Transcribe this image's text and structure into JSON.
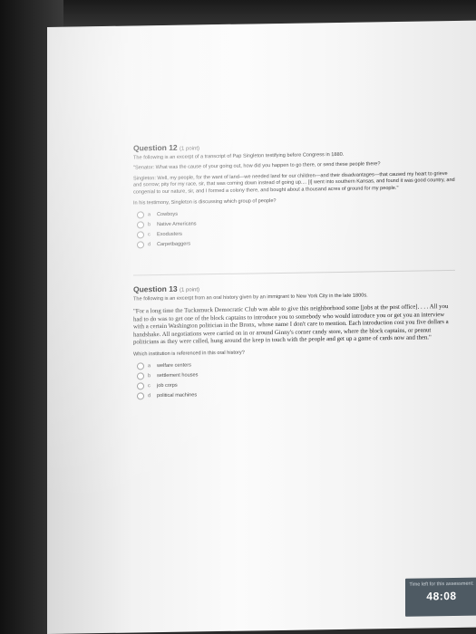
{
  "q12": {
    "title": "Question 12",
    "points": "(1 point)",
    "intro": "The following is an excerpt of a transcript of Pap Singleton testifying before Congress in 1880.",
    "question_line": "\"Senator: What was the cause of your going out, how did you happen to go there, or send these people there?",
    "answer": "Singleton: Well, my people, for the want of land—we needed land for our children—and their disadvantages—that caused my heart to grieve and sorrow; pity for my race, sir, that was coming down instead of going up.... [I] went into southern Kansas, and found it was good country, and congenial to our nature, sir, and I formed a colony there, and bought about a thousand acres of ground for my people.\"",
    "prompt": "In his testimony, Singleton is discussing which group of people?",
    "options": [
      {
        "letter": "a",
        "label": "Cowboys"
      },
      {
        "letter": "b",
        "label": "Native Americans"
      },
      {
        "letter": "c",
        "label": "Exodusters"
      },
      {
        "letter": "d",
        "label": "Carpetbaggers"
      }
    ]
  },
  "q13": {
    "title": "Question 13",
    "points": "(1 point)",
    "intro": "The following is an excerpt from an oral history given by an immigrant to New York City in the late 1800s.",
    "quote": "\"For a long time the Tuckamuck Democratic Club was able to give this neighborhood some [jobs at the post office]. . . . All you had to do was to get one of the block captains to introduce you to somebody who would introduce you or get you an interview with a certain Washington politician in the Bronx, whose name I don't care to mention. Each introduction cost you five dollars a handshake. All negotiations were carried on in or around Ginny's corner candy store, where the block captains, or peanut politicians as they were called, hung around the keep in touch with the people and get up a game of cards now and then.\"",
    "prompt": "Which institution is referenced in this oral history?",
    "options": [
      {
        "letter": "a",
        "label": "welfare centers"
      },
      {
        "letter": "b",
        "label": "settlement houses"
      },
      {
        "letter": "c",
        "label": "job corps"
      },
      {
        "letter": "d",
        "label": "political machines"
      }
    ]
  },
  "timer": {
    "label": "Time left for this assessment:",
    "time": "48:08"
  }
}
